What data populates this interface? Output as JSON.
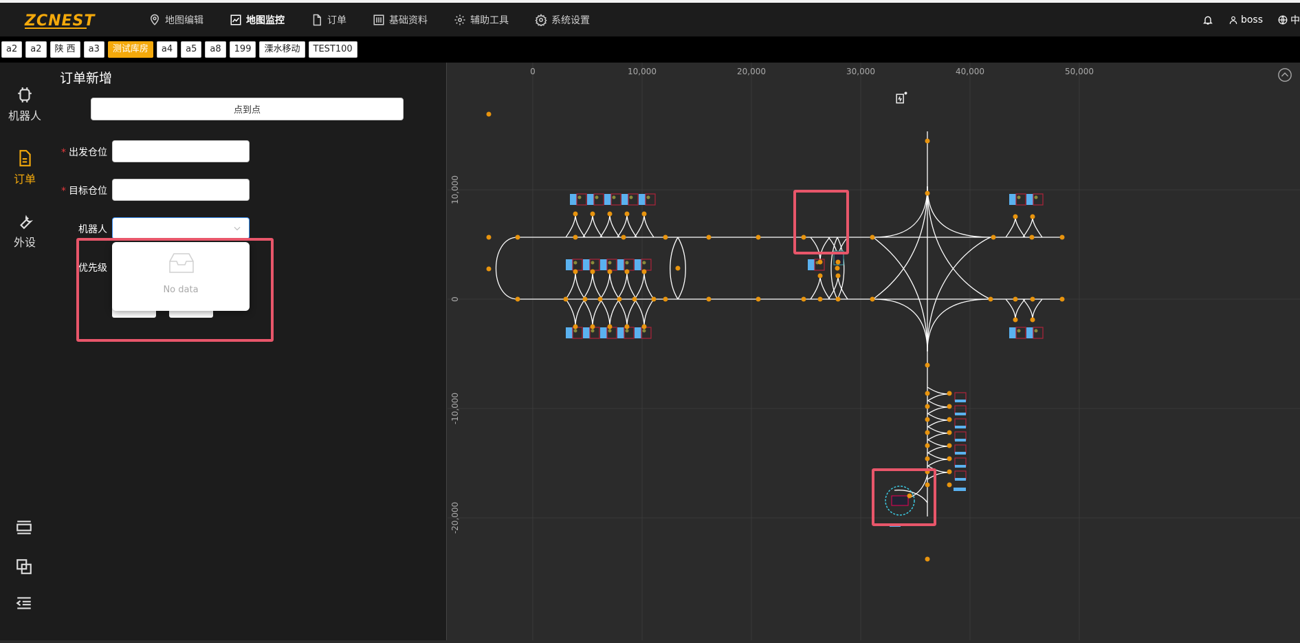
{
  "app": {
    "logo": "ZCNEST"
  },
  "nav": [
    {
      "label": "地图编辑",
      "icon": "map-pin-icon"
    },
    {
      "label": "地图监控",
      "icon": "chart-line-icon",
      "active": true
    },
    {
      "label": "订单",
      "icon": "document-icon"
    },
    {
      "label": "基础资料",
      "icon": "sliders-icon"
    },
    {
      "label": "辅助工具",
      "icon": "gear-icon"
    },
    {
      "label": "系统设置",
      "icon": "settings-icon"
    }
  ],
  "topright": {
    "user": "boss",
    "lang": "中"
  },
  "tabs": [
    "a2",
    "a2",
    "陕 西",
    "a3",
    "测试库房",
    "a4",
    "a5",
    "a8",
    "199",
    "溧水移动",
    "TEST100"
  ],
  "active_tab": "测试库房",
  "sidebar": {
    "items": [
      {
        "label": "机器人",
        "icon": "robot-icon"
      },
      {
        "label": "订单",
        "icon": "document-icon",
        "active": true
      },
      {
        "label": "外设",
        "icon": "wrench-icon"
      }
    ]
  },
  "panel": {
    "title": "订单新增",
    "p2p_button": "点到点",
    "fields": {
      "from_label": "出发仓位",
      "from_value": "",
      "to_label": "目标仓位",
      "to_value": "",
      "robot_label": "机器人",
      "robot_value": "",
      "priority_label": "优先级"
    },
    "dropdown_empty": "No data"
  },
  "map": {
    "x_ticks": [
      "0",
      "10,000",
      "20,000",
      "30,000",
      "40,000",
      "50,000"
    ],
    "y_ticks": [
      "10,000",
      "0",
      "-10,000",
      "-20,000"
    ],
    "colors": {
      "node": "#e8940e",
      "path": "#ffffff",
      "grid": "#3a3a3a",
      "highlight": "#e8566a",
      "marker": "#5ab1ef"
    }
  }
}
